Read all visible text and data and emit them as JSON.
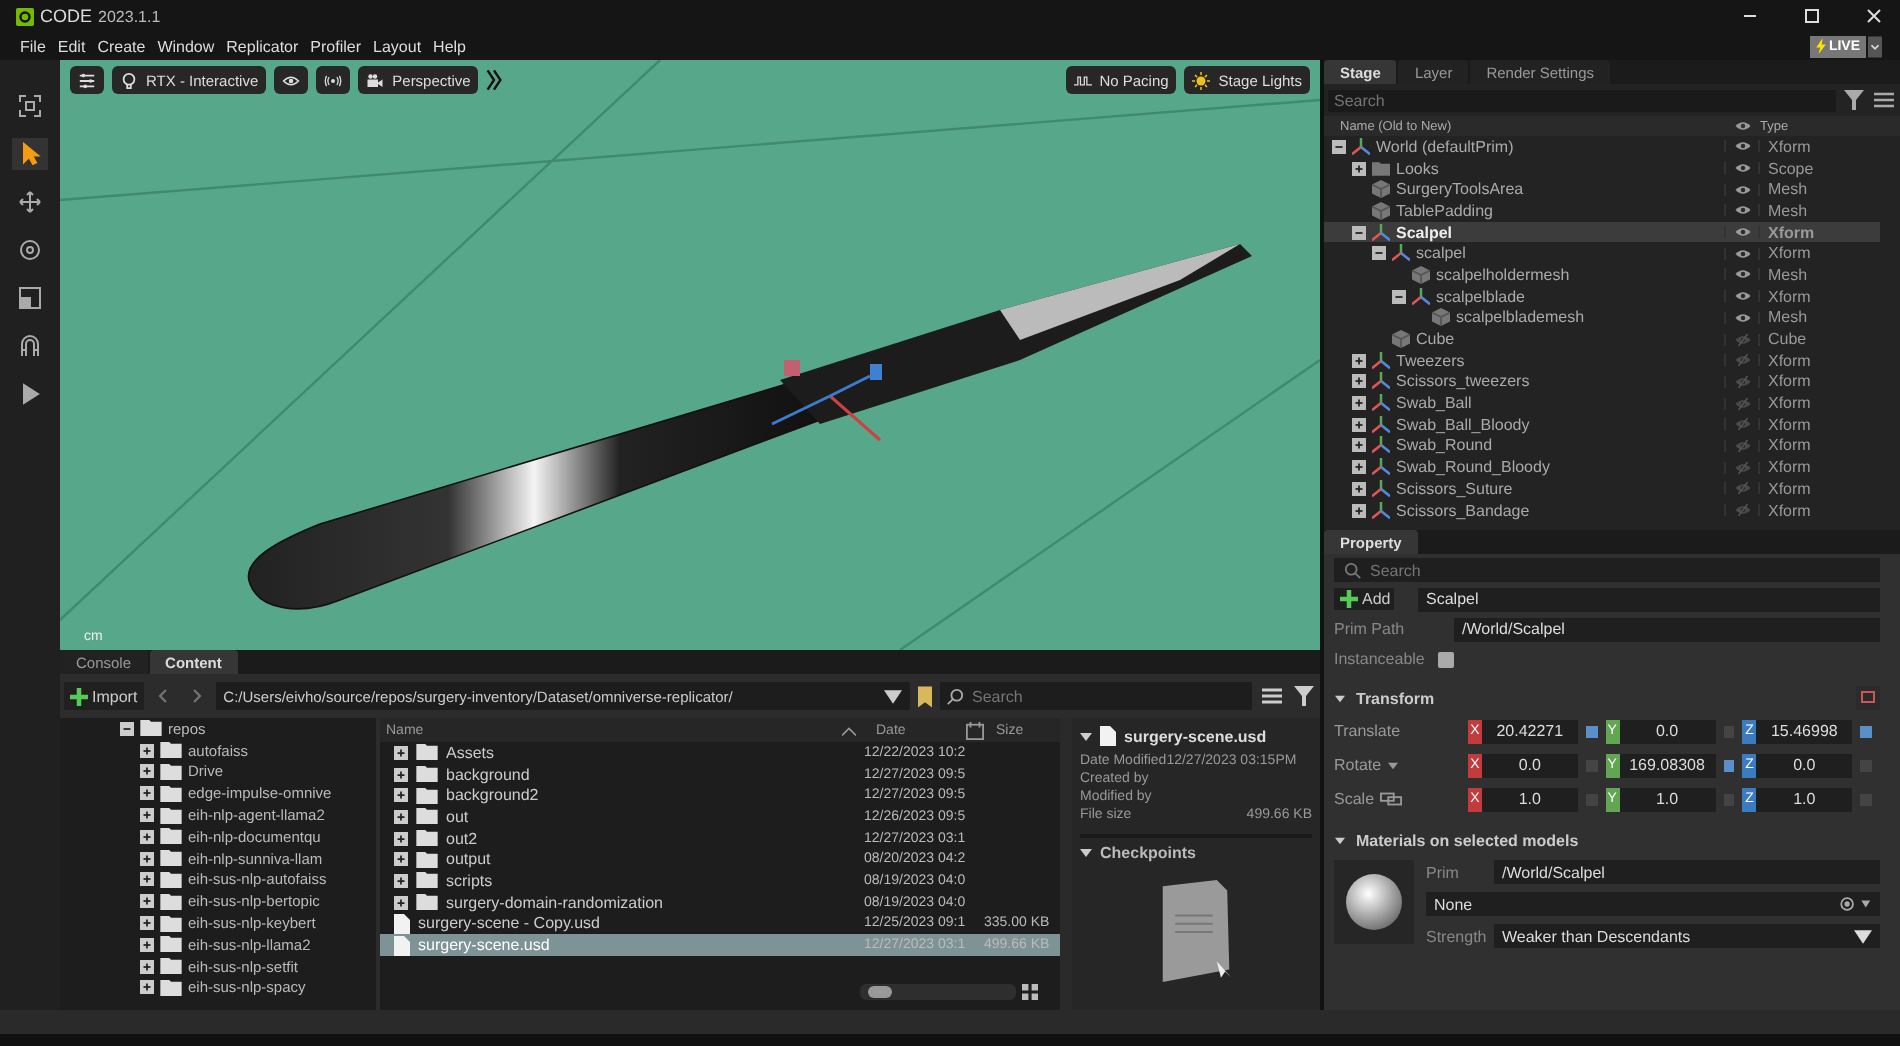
{
  "app": {
    "title": "CODE",
    "version": "2023.1.1"
  },
  "menu": [
    "File",
    "Edit",
    "Create",
    "Window",
    "Replicator",
    "Profiler",
    "Layout",
    "Help"
  ],
  "live": {
    "label": "LIVE"
  },
  "tools": [
    {
      "kind": "frame",
      "selected": false
    },
    {
      "kind": "select",
      "selected": true
    },
    {
      "kind": "move",
      "selected": false
    },
    {
      "kind": "rotate",
      "selected": false
    },
    {
      "kind": "scale",
      "selected": false
    },
    {
      "kind": "snap",
      "selected": false
    },
    {
      "kind": "play",
      "selected": false
    }
  ],
  "viewport": {
    "renderer": "RTX - Interactive",
    "camera": "Perspective",
    "pacing": "No Pacing",
    "lights": "Stage Lights",
    "units": "cm"
  },
  "stage": {
    "tabs": [
      {
        "label": "Stage",
        "selected": true
      },
      {
        "label": "Layer",
        "selected": false
      },
      {
        "label": "Render Settings",
        "selected": false
      }
    ],
    "search": {
      "placeholder": "Search"
    },
    "columns": [
      "Name (Old to New)",
      "Type"
    ],
    "tree": [
      {
        "name": "World (defaultPrim)",
        "type": "Xform",
        "expanded": true,
        "visible": true,
        "selected": false,
        "children": [
          {
            "name": "Looks",
            "type": "Scope",
            "expanded": false,
            "visible": true,
            "selected": false
          },
          {
            "name": "SurgeryToolsArea",
            "type": "Mesh",
            "visible": true,
            "selected": false
          },
          {
            "name": "TablePadding",
            "type": "Mesh",
            "visible": true,
            "selected": false
          },
          {
            "name": "Scalpel",
            "type": "Xform",
            "expanded": true,
            "visible": true,
            "selected": true,
            "children": [
              {
                "name": "scalpel",
                "type": "Xform",
                "expanded": true,
                "visible": true,
                "selected": false,
                "children": [
                  {
                    "name": "scalpelholdermesh",
                    "type": "Mesh",
                    "visible": true,
                    "selected": false
                  },
                  {
                    "name": "scalpelblade",
                    "type": "Xform",
                    "expanded": true,
                    "visible": true,
                    "selected": false,
                    "children": [
                      {
                        "name": "scalpelblademesh",
                        "type": "Mesh",
                        "visible": true,
                        "selected": false
                      }
                    ]
                  }
                ]
              },
              {
                "name": "Cube",
                "type": "Cube",
                "visible": false,
                "selected": false
              }
            ]
          },
          {
            "name": "Tweezers",
            "type": "Xform",
            "expanded": false,
            "visible": false,
            "selected": false
          },
          {
            "name": "Scissors_tweezers",
            "type": "Xform",
            "expanded": false,
            "visible": false,
            "selected": false
          },
          {
            "name": "Swab_Ball",
            "type": "Xform",
            "expanded": false,
            "visible": false,
            "selected": false
          },
          {
            "name": "Swab_Ball_Bloody",
            "type": "Xform",
            "expanded": false,
            "visible": false,
            "selected": false
          },
          {
            "name": "Swab_Round",
            "type": "Xform",
            "expanded": false,
            "visible": false,
            "selected": false
          },
          {
            "name": "Swab_Round_Bloody",
            "type": "Xform",
            "expanded": false,
            "visible": false,
            "selected": false
          },
          {
            "name": "Scissors_Suture",
            "type": "Xform",
            "expanded": false,
            "visible": false,
            "selected": false
          },
          {
            "name": "Scissors_Bandage",
            "type": "Xform",
            "expanded": false,
            "visible": false,
            "selected": false
          }
        ]
      }
    ]
  },
  "property": {
    "tab": "Property",
    "search": {
      "placeholder": "Search"
    },
    "add": "Add",
    "name": "Scalpel",
    "prim_path": {
      "label": "Prim Path",
      "value": "/World/Scalpel"
    },
    "instanceable": {
      "label": "Instanceable",
      "checked": false
    },
    "transform": {
      "title": "Transform",
      "expanded": true,
      "rows": [
        {
          "label": "Translate",
          "kind": "plain",
          "axes": [
            {
              "axis": "X",
              "color": "#c23b3d",
              "value": "20.42271",
              "authored": true
            },
            {
              "axis": "Y",
              "color": "#62a552",
              "value": "0.0",
              "authored": false
            },
            {
              "axis": "Z",
              "color": "#3b7cc0",
              "value": "15.46998",
              "authored": true
            }
          ]
        },
        {
          "label": "Rotate",
          "kind": "caret",
          "axes": [
            {
              "axis": "X",
              "color": "#c23b3d",
              "value": "0.0",
              "authored": false
            },
            {
              "axis": "Y",
              "color": "#62a552",
              "value": "169.08308",
              "authored": true
            },
            {
              "axis": "Z",
              "color": "#3b7cc0",
              "value": "0.0",
              "authored": false
            }
          ]
        },
        {
          "label": "Scale",
          "kind": "link",
          "axes": [
            {
              "axis": "X",
              "color": "#c23b3d",
              "value": "1.0",
              "authored": false
            },
            {
              "axis": "Y",
              "color": "#62a552",
              "value": "1.0",
              "authored": false
            },
            {
              "axis": "Z",
              "color": "#3b7cc0",
              "value": "1.0",
              "authored": false
            }
          ]
        }
      ]
    },
    "materials": {
      "title": "Materials on selected models",
      "expanded": true,
      "prim_label": "Prim",
      "prim": "/World/Scalpel",
      "material": "None",
      "strength_label": "Strength",
      "strength": "Weaker than Descendants"
    }
  },
  "content": {
    "tabs": [
      {
        "label": "Console",
        "selected": false
      },
      {
        "label": "Content",
        "selected": true
      }
    ],
    "import": "Import",
    "path": "C:/Users/eivho/source/repos/surgery-inventory/Dataset/omniverse-replicator/",
    "search": {
      "placeholder": "Search"
    },
    "folders": [
      {
        "name": "repos",
        "expanded": true,
        "children": [
          {
            "name": "autofaiss",
            "expanded": false
          },
          {
            "name": "Drive",
            "expanded": false
          },
          {
            "name": "edge-impulse-omnive",
            "expanded": false
          },
          {
            "name": "eih-nlp-agent-llama2",
            "expanded": false
          },
          {
            "name": "eih-nlp-documentqu",
            "expanded": false
          },
          {
            "name": "eih-nlp-sunniva-llam",
            "expanded": false
          },
          {
            "name": "eih-sus-nlp-autofaiss",
            "expanded": false
          },
          {
            "name": "eih-sus-nlp-bertopic",
            "expanded": false
          },
          {
            "name": "eih-sus-nlp-keybert",
            "expanded": false
          },
          {
            "name": "eih-sus-nlp-llama2",
            "expanded": false
          },
          {
            "name": "eih-sus-nlp-setfit",
            "expanded": false
          },
          {
            "name": "eih-sus-nlp-spacy",
            "expanded": false
          }
        ]
      }
    ],
    "columns": [
      "Name",
      "Date",
      "Size"
    ],
    "files": [
      {
        "name": "Assets",
        "kind": "folder",
        "date": "12/22/2023 10:2",
        "selected": false
      },
      {
        "name": "background",
        "kind": "folder",
        "date": "12/27/2023 09:5",
        "selected": false
      },
      {
        "name": "background2",
        "kind": "folder",
        "date": "12/27/2023 09:5",
        "selected": false
      },
      {
        "name": "out",
        "kind": "folder",
        "date": "12/26/2023 09:5",
        "selected": false
      },
      {
        "name": "out2",
        "kind": "folder",
        "date": "12/27/2023 03:1",
        "selected": false
      },
      {
        "name": "output",
        "kind": "folder",
        "date": "08/20/2023 04:2",
        "selected": false
      },
      {
        "name": "scripts",
        "kind": "folder",
        "date": "08/19/2023 04:0",
        "selected": false
      },
      {
        "name": "surgery-domain-randomization",
        "kind": "folder",
        "date": "08/19/2023 04:0",
        "selected": false
      },
      {
        "name": "surgery-scene - Copy.usd",
        "kind": "file",
        "date": "12/25/2023 09:1",
        "size": "335.00 KB",
        "selected": false
      },
      {
        "name": "surgery-scene.usd",
        "kind": "file",
        "date": "12/27/2023 03:1",
        "size": "499.66 KB",
        "selected": true
      }
    ],
    "details": {
      "name": "surgery-scene.usd",
      "fields": [
        {
          "label": "Date Modified",
          "value": "12/27/2023 03:15PM"
        },
        {
          "label": "Created by"
        },
        {
          "label": "Modified by"
        },
        {
          "label": "File size",
          "value": "499.66 KB"
        }
      ],
      "checkpoints": "Checkpoints"
    }
  }
}
